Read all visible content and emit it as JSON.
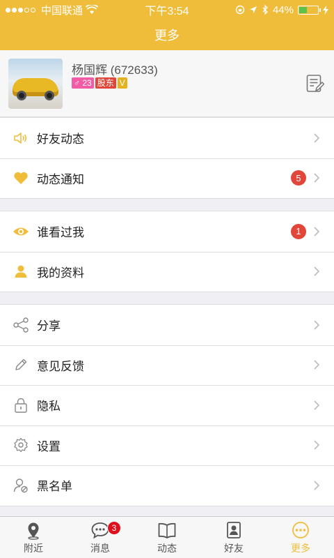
{
  "status": {
    "carrier": "中国联通",
    "time": "下午3:54",
    "battery": "44%",
    "battery_level": 0.44
  },
  "nav": {
    "title": "更多"
  },
  "profile": {
    "name": "杨国辉 (672633)",
    "gender_age": "♂ 23",
    "role": "股东",
    "vip": "V"
  },
  "groups": [
    {
      "items": [
        {
          "label": "好友动态",
          "icon": "speaker-icon",
          "count": null
        },
        {
          "label": "动态通知",
          "icon": "heart-icon",
          "count": "5"
        }
      ]
    },
    {
      "items": [
        {
          "label": "谁看过我",
          "icon": "eye-icon",
          "count": "1"
        },
        {
          "label": "我的资料",
          "icon": "person-icon",
          "count": null
        }
      ]
    },
    {
      "items": [
        {
          "label": "分享",
          "icon": "share-icon",
          "count": null
        },
        {
          "label": "意见反馈",
          "icon": "pencil-icon",
          "count": null
        },
        {
          "label": "隐私",
          "icon": "lock-icon",
          "count": null
        },
        {
          "label": "设置",
          "icon": "gear-icon",
          "count": null
        },
        {
          "label": "黑名单",
          "icon": "block-user-icon",
          "count": null
        }
      ]
    }
  ],
  "tabs": [
    {
      "label": "附近",
      "icon": "location-pin-icon",
      "count": null
    },
    {
      "label": "消息",
      "icon": "chat-bubble-icon",
      "count": "3"
    },
    {
      "label": "动态",
      "icon": "book-icon",
      "count": null
    },
    {
      "label": "好友",
      "icon": "friends-icon",
      "count": null
    },
    {
      "label": "更多",
      "icon": "more-icon",
      "count": null
    }
  ],
  "colors": {
    "accent": "#f0bd3a",
    "badge_red": "#e0473a"
  }
}
